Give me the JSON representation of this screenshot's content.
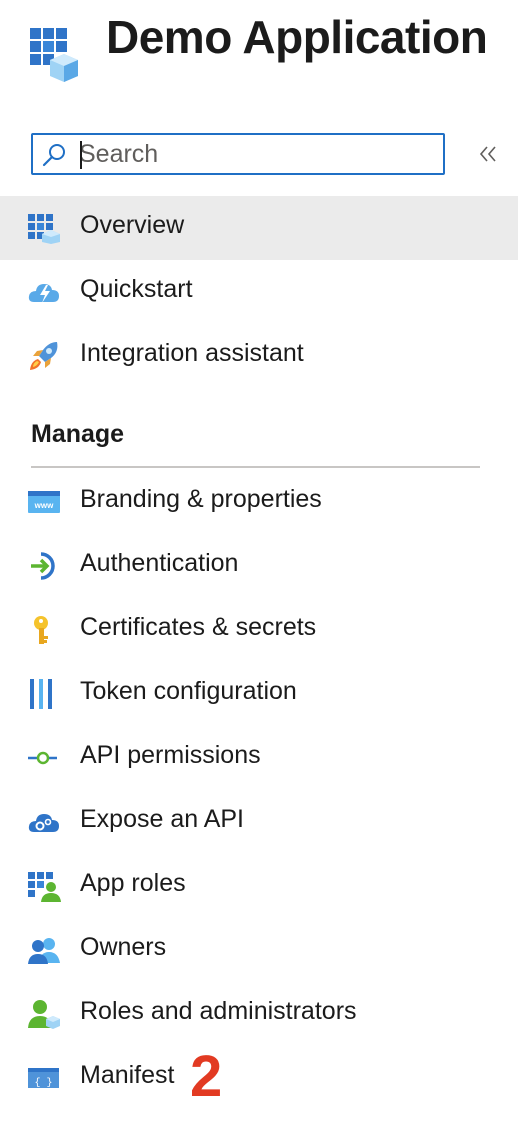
{
  "header": {
    "title": "Demo Application",
    "logo_icon": "app-grid-cube-icon"
  },
  "search": {
    "placeholder": "Search",
    "value": "",
    "icon": "search-icon"
  },
  "collapse": {
    "glyph": "«",
    "icon": "double-chevron-left-icon"
  },
  "nav_top": [
    {
      "label": "Overview",
      "icon": "app-grid-cube-icon",
      "selected": true
    },
    {
      "label": "Quickstart",
      "icon": "cloud-lightning-icon",
      "selected": false
    },
    {
      "label": "Integration assistant",
      "icon": "rocket-icon",
      "selected": false
    }
  ],
  "manage": {
    "title": "Manage",
    "items": [
      {
        "label": "Branding & properties",
        "icon": "www-window-icon"
      },
      {
        "label": "Authentication",
        "icon": "sign-in-arrow-icon"
      },
      {
        "label": "Certificates & secrets",
        "icon": "key-icon"
      },
      {
        "label": "Token configuration",
        "icon": "token-bars-icon"
      },
      {
        "label": "API permissions",
        "icon": "api-link-icon"
      },
      {
        "label": "Expose an API",
        "icon": "cloud-gear-icon"
      },
      {
        "label": "App roles",
        "icon": "app-roles-grid-user-icon"
      },
      {
        "label": "Owners",
        "icon": "two-users-icon"
      },
      {
        "label": "Roles and administrators",
        "icon": "user-roles-icon"
      },
      {
        "label": "Manifest",
        "icon": "manifest-braces-icon"
      }
    ]
  },
  "annotation": {
    "text": "2",
    "color": "#e23a22"
  },
  "colors": {
    "accent": "#1f6fc5",
    "selected_bg": "#ebebeb",
    "divider": "#c8c6c4"
  }
}
